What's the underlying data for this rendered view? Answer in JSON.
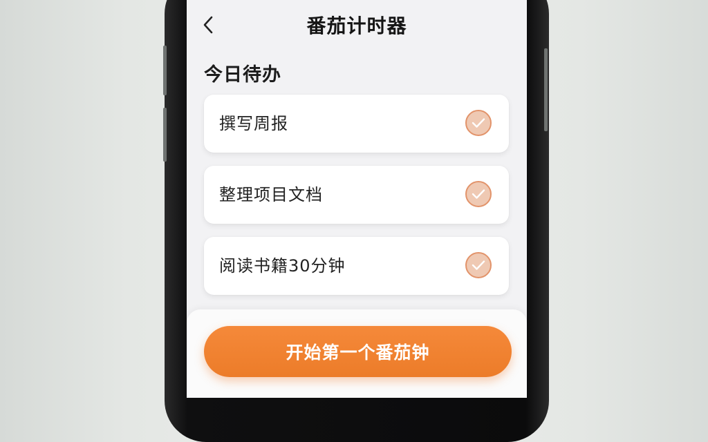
{
  "header": {
    "title": "番茄计时器",
    "back_icon": "chevron-left-icon"
  },
  "todo": {
    "section_title": "今日待办",
    "tasks": [
      {
        "label": "撰写周报",
        "checked": true
      },
      {
        "label": "整理项目文档",
        "checked": true
      },
      {
        "label": "阅读书籍30分钟",
        "checked": true
      }
    ],
    "check_icon": "checkmark-icon"
  },
  "footer": {
    "start_label": "开始第一个番茄钟"
  },
  "colors": {
    "accent": "#F28432",
    "check_fill": "#EFC9B3",
    "check_border": "#E2936A",
    "background": "#F2F2F4"
  }
}
